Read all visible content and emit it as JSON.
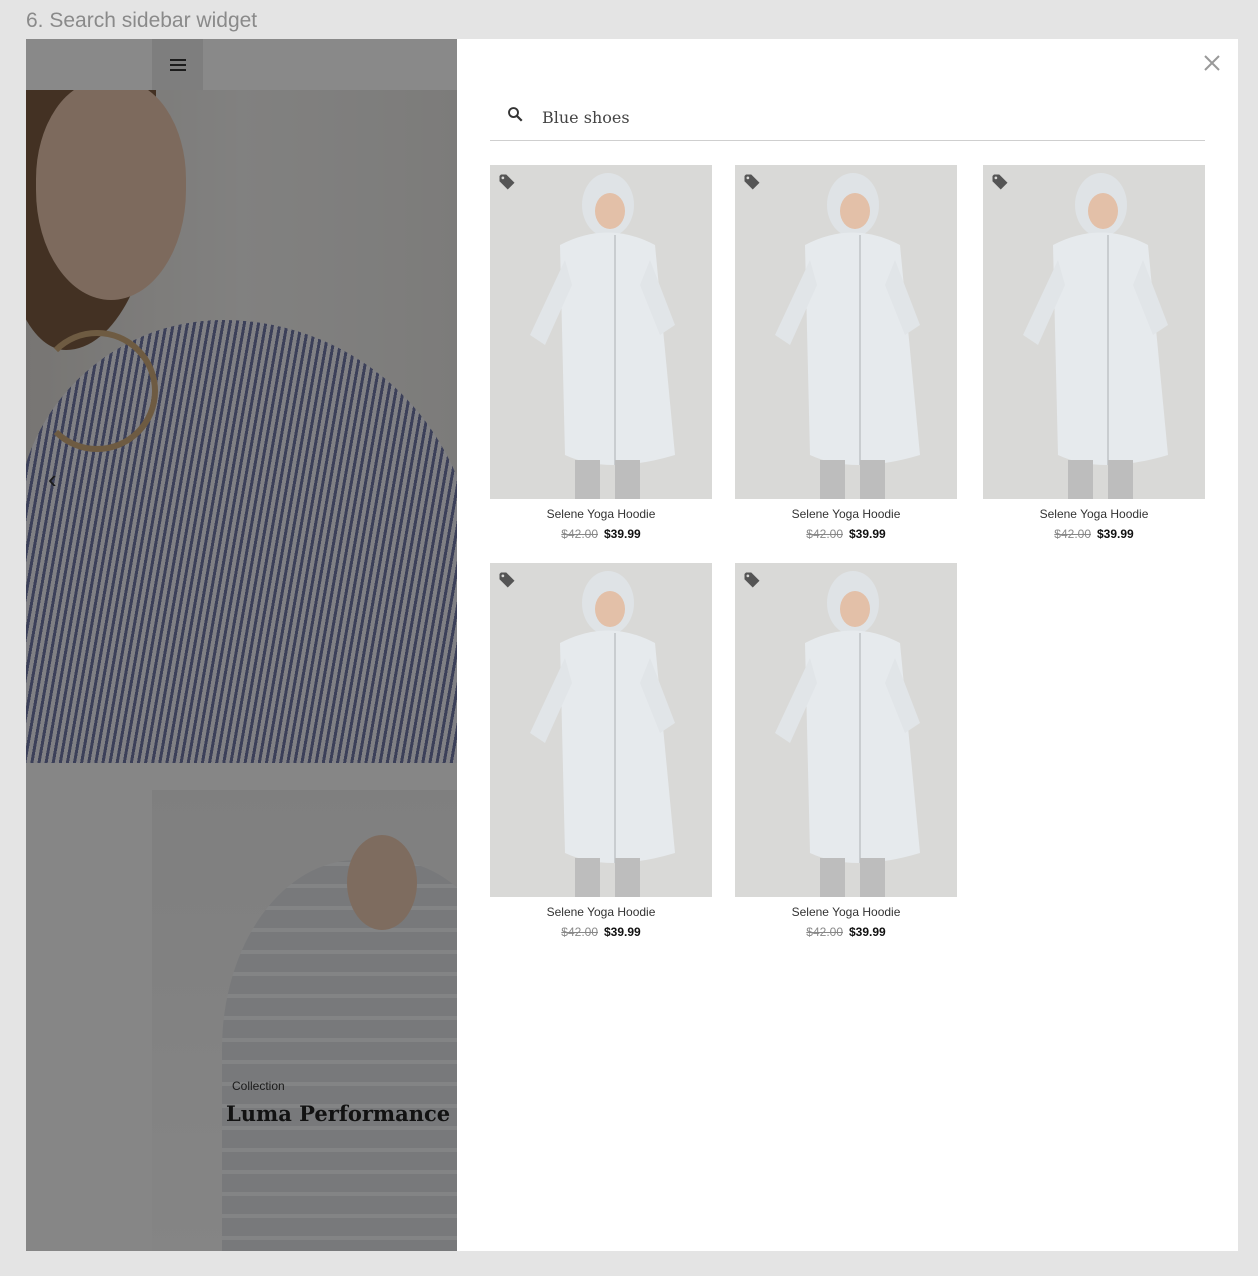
{
  "section_title": "6. Search sidebar widget",
  "background_page": {
    "promo_subtitle": "Collection",
    "promo_title": "Luma Performance new c"
  },
  "search": {
    "value": "Blue shoes"
  },
  "products": [
    {
      "name": "Selene Yoga Hoodie",
      "old_price": "$42.00",
      "price": "$39.99"
    },
    {
      "name": "Selene Yoga Hoodie",
      "old_price": "$42.00",
      "price": "$39.99"
    },
    {
      "name": "Selene Yoga Hoodie",
      "old_price": "$42.00",
      "price": "$39.99"
    },
    {
      "name": "Selene Yoga Hoodie",
      "old_price": "$42.00",
      "price": "$39.99"
    },
    {
      "name": "Selene Yoga Hoodie",
      "old_price": "$42.00",
      "price": "$39.99"
    }
  ],
  "colors": {
    "overlay": "#000000",
    "accent": "#111111",
    "muted": "#888888"
  },
  "icons": [
    "menu-icon",
    "chevron-left-icon",
    "close-icon",
    "search-icon",
    "tag-icon"
  ]
}
